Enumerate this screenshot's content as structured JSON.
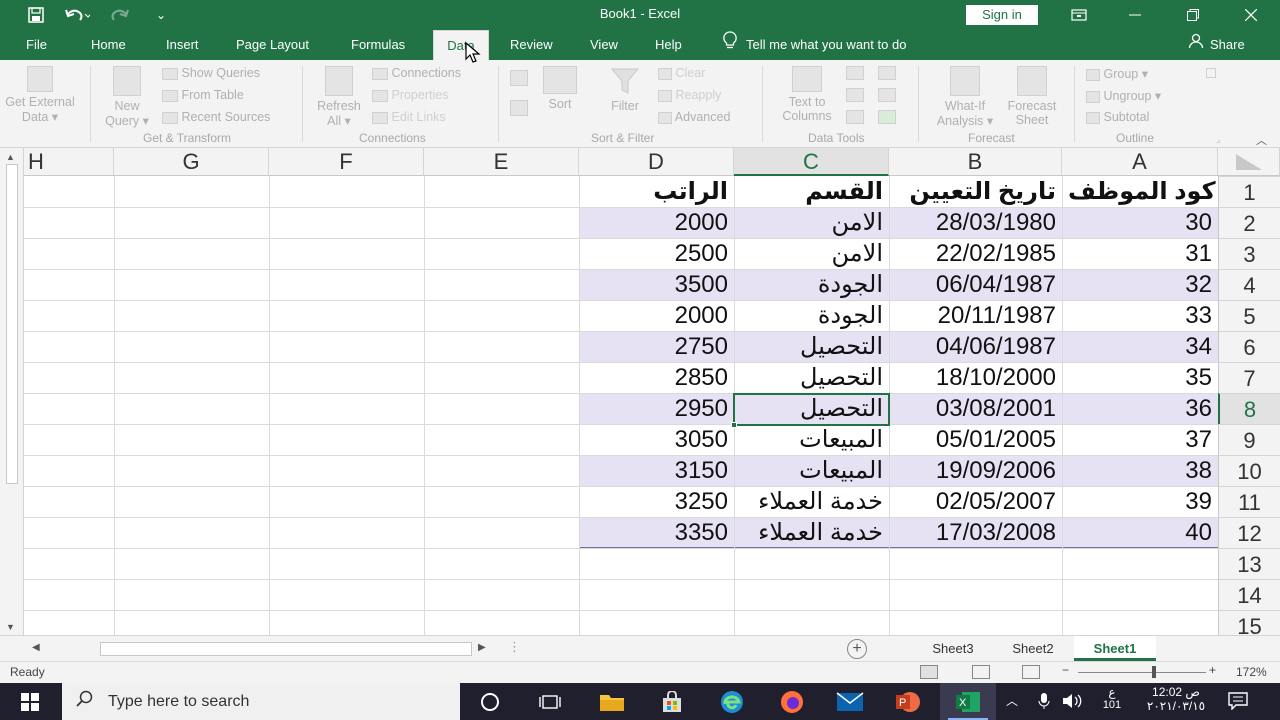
{
  "titlebar": {
    "title": "Book1  -  Excel",
    "signin": "Sign in"
  },
  "tabs": [
    "File",
    "Home",
    "Insert",
    "Page Layout",
    "Formulas",
    "Data",
    "Review",
    "View",
    "Help"
  ],
  "tell_me": "Tell me what you want to do",
  "share": "Share",
  "ribbon": {
    "get_external": [
      "Get External",
      "Data"
    ],
    "new_query": [
      "New",
      "Query"
    ],
    "show_queries": "Show Queries",
    "from_table": "From Table",
    "recent_sources": "Recent Sources",
    "get_transform": "Get & Transform",
    "refresh": [
      "Refresh",
      "All"
    ],
    "connections": "Connections",
    "properties": "Properties",
    "edit_links": "Edit Links",
    "connections_group": "Connections",
    "sort": "Sort",
    "filter": "Filter",
    "clear": "Clear",
    "reapply": "Reapply",
    "advanced": "Advanced",
    "sort_filter": "Sort & Filter",
    "text_to_columns": [
      "Text to",
      "Columns"
    ],
    "data_tools": "Data Tools",
    "what_if": [
      "What-If",
      "Analysis"
    ],
    "forecast_sheet": [
      "Forecast",
      "Sheet"
    ],
    "forecast": "Forecast",
    "group": "Group",
    "ungroup": "Ungroup",
    "subtotal": "Subtotal",
    "outline": "Outline"
  },
  "columns": [
    "H",
    "G",
    "F",
    "E",
    "D",
    "C",
    "B",
    "A"
  ],
  "rows": [
    "1",
    "2",
    "3",
    "4",
    "5",
    "6",
    "7",
    "8",
    "9",
    "10",
    "11",
    "12",
    "13",
    "14",
    "15"
  ],
  "headers": {
    "A": "كود الموظف",
    "B": "تاريخ التعيين",
    "C": "القسم",
    "D": "الراتب"
  },
  "records": [
    {
      "A": "30",
      "B": "28/03/1980",
      "C": "الامن",
      "D": "2000"
    },
    {
      "A": "31",
      "B": "22/02/1985",
      "C": "الامن",
      "D": "2500"
    },
    {
      "A": "32",
      "B": "06/04/1987",
      "C": "الجودة",
      "D": "3500"
    },
    {
      "A": "33",
      "B": "20/11/1987",
      "C": "الجودة",
      "D": "2000"
    },
    {
      "A": "34",
      "B": "04/06/1987",
      "C": "التحصيل",
      "D": "2750"
    },
    {
      "A": "35",
      "B": "18/10/2000",
      "C": "التحصيل",
      "D": "2850"
    },
    {
      "A": "36",
      "B": "03/08/2001",
      "C": "التحصيل",
      "D": "2950"
    },
    {
      "A": "37",
      "B": "05/01/2005",
      "C": "المبيعات",
      "D": "3050"
    },
    {
      "A": "38",
      "B": "19/09/2006",
      "C": "المبيعات",
      "D": "3150"
    },
    {
      "A": "39",
      "B": "02/05/2007",
      "C": "خدمة العملاء",
      "D": "3250"
    },
    {
      "A": "40",
      "B": "17/03/2008",
      "C": "خدمة العملاء",
      "D": "3350"
    }
  ],
  "sheets": [
    "Sheet3",
    "Sheet2",
    "Sheet1"
  ],
  "active_sheet": "Sheet1",
  "status": "Ready",
  "zoom": "172%",
  "taskbar": {
    "search_placeholder": "Type here to search",
    "lang": "ع",
    "time": "12:02 ص",
    "date": "٢٠٢١/٠٣/١٥",
    "notif": "101"
  },
  "colors": {
    "accent": "#217346",
    "band": "#e7e2f3",
    "band_border": "#7b6ca8"
  }
}
